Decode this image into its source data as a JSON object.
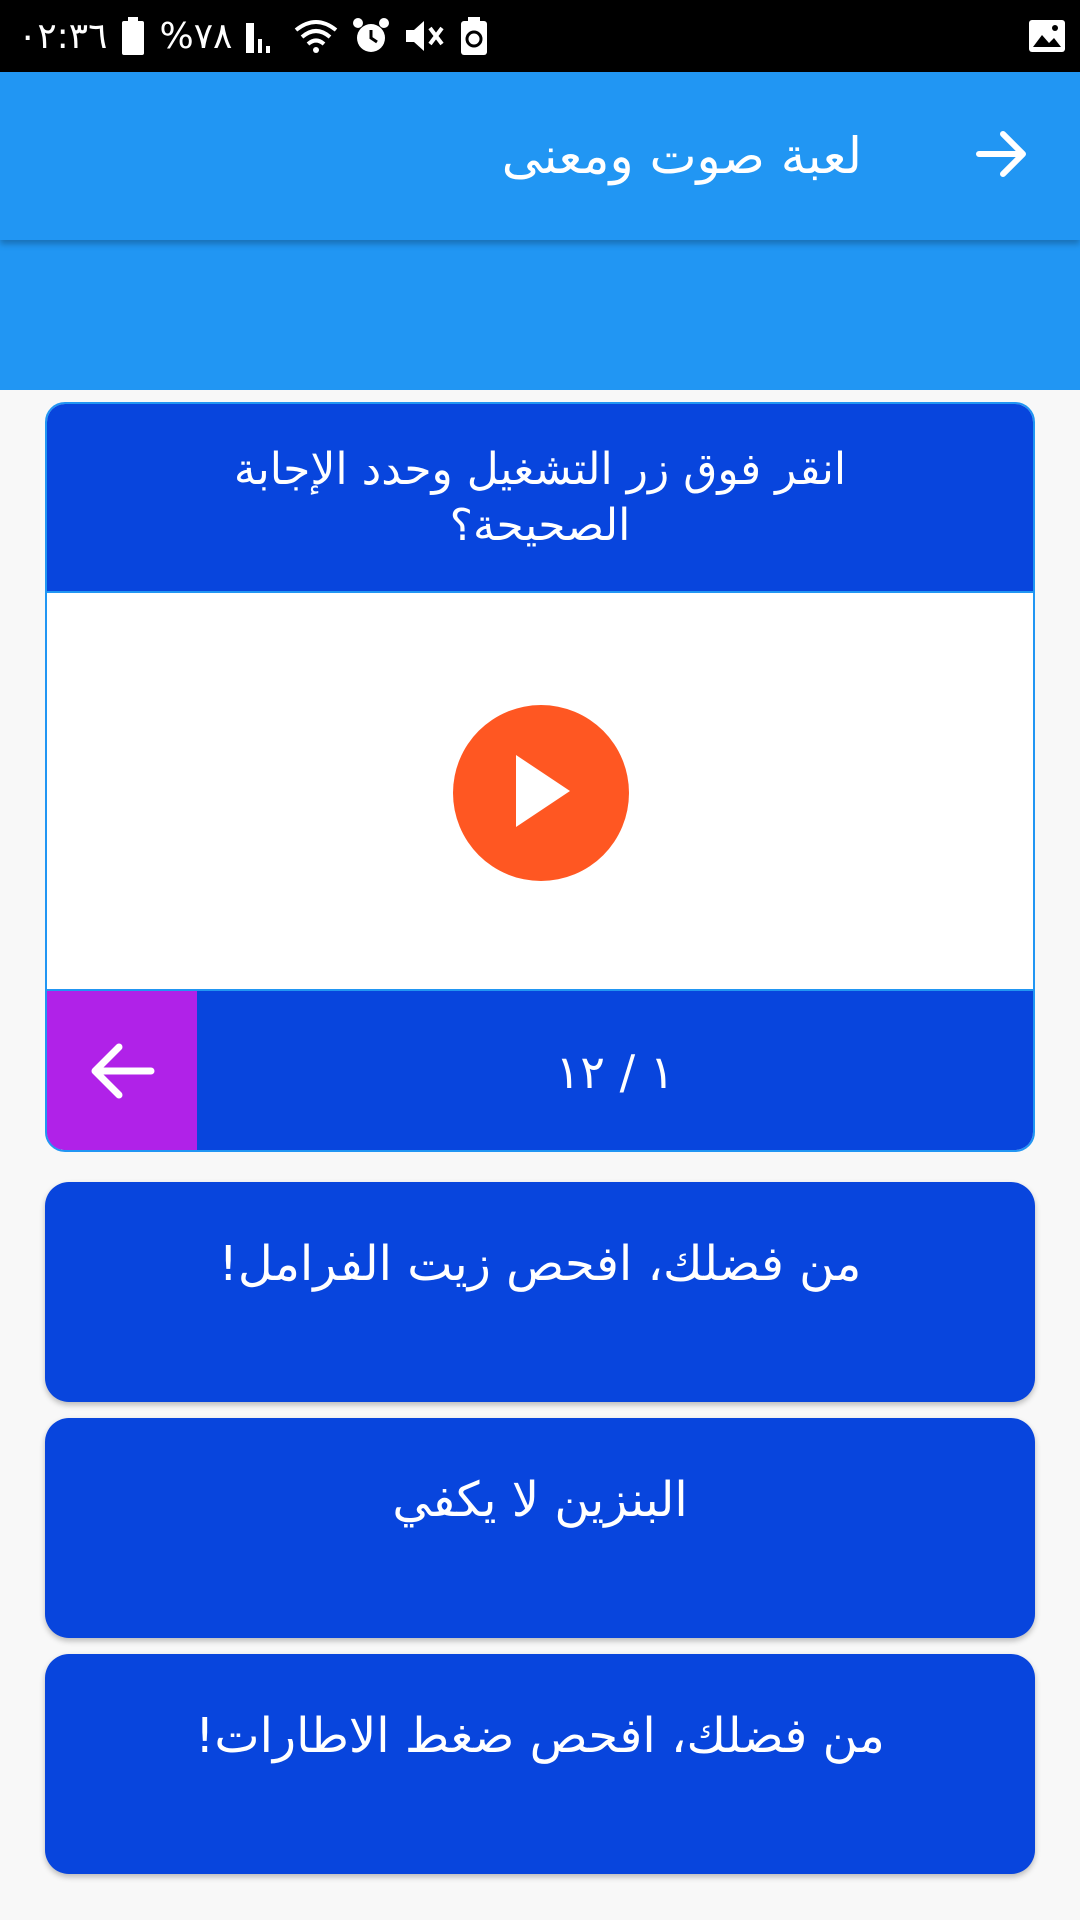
{
  "status_bar": {
    "time": "٠٢:٣٦",
    "battery": "%٧٨",
    "icons": [
      "battery-icon",
      "signal-icon",
      "wifi-icon",
      "alarm-icon",
      "mute-icon",
      "recycle-icon",
      "gallery-icon"
    ]
  },
  "app_bar": {
    "title": "لعبة صوت ومعنى",
    "back_icon": "arrow-right-icon"
  },
  "question": {
    "text": "انقر فوق زر التشغيل وحدد الإجابة الصحيحة؟",
    "play_icon": "play-icon",
    "progress": "١ / ١٢",
    "next_icon": "arrow-left-icon"
  },
  "answers": [
    {
      "label": "من فضلك، افحص زيت الفرامل!"
    },
    {
      "label": "البنزين لا يكفي"
    },
    {
      "label": "من فضلك، افحص ضغط الاطارات!"
    }
  ],
  "colors": {
    "app_bar": "#2196f3",
    "card_blue": "#0845dd",
    "next_purple": "#b022e8",
    "play_orange": "#ff5722",
    "background": "#f8f8f8"
  }
}
